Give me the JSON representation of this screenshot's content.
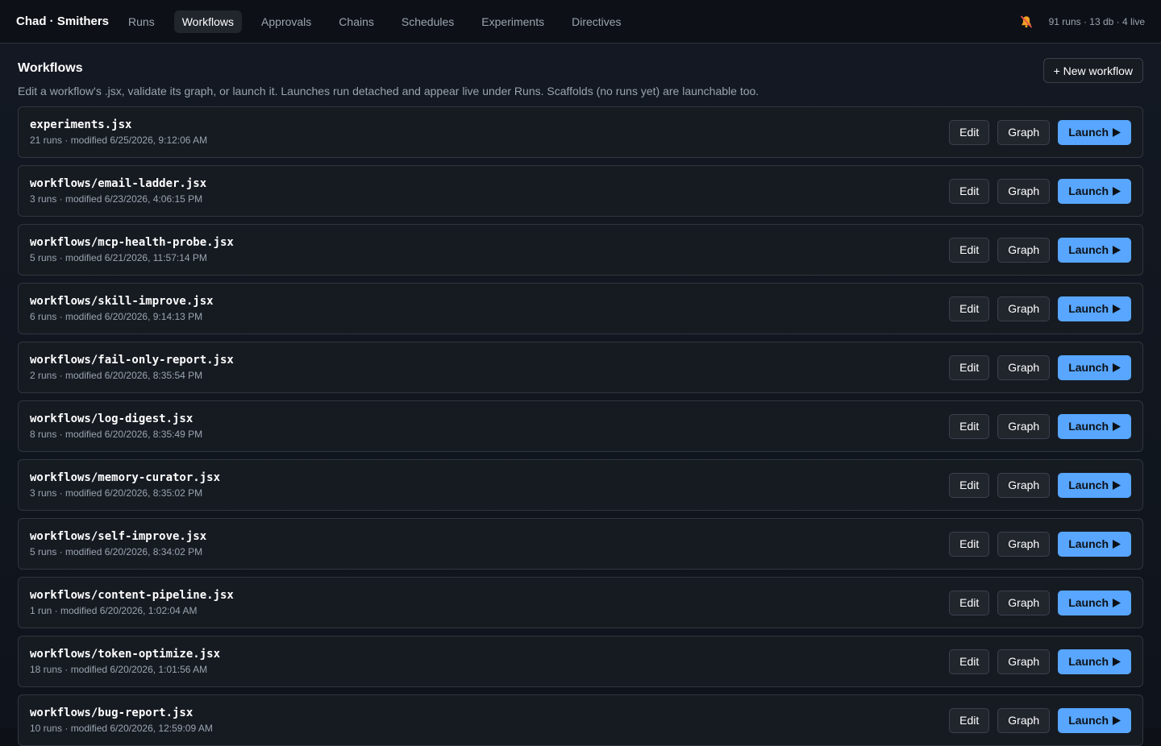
{
  "brand": "Chad · Smithers",
  "nav": [
    {
      "label": "Runs",
      "active": false
    },
    {
      "label": "Workflows",
      "active": true
    },
    {
      "label": "Approvals",
      "active": false
    },
    {
      "label": "Chains",
      "active": false
    },
    {
      "label": "Schedules",
      "active": false
    },
    {
      "label": "Experiments",
      "active": false
    },
    {
      "label": "Directives",
      "active": false
    }
  ],
  "status": {
    "text": "91 runs · 13 db · 4 live",
    "bell_icon": "bell-muted-icon"
  },
  "page": {
    "title": "Workflows",
    "description": "Edit a workflow's .jsx, validate its graph, or launch it. Launches run detached and appear live under Runs. Scaffolds (no runs yet) are launchable too.",
    "new_button": "+ New workflow"
  },
  "actions": {
    "edit": "Edit",
    "graph": "Graph",
    "launch": "Launch"
  },
  "colors": {
    "accent": "#58a6ff",
    "background": "#0d1117",
    "bell": "#f0a020"
  },
  "workflows": [
    {
      "name": "experiments.jsx",
      "meta": "21 runs · modified 6/25/2026, 9:12:06 AM"
    },
    {
      "name": "workflows/email-ladder.jsx",
      "meta": "3 runs · modified 6/23/2026, 4:06:15 PM"
    },
    {
      "name": "workflows/mcp-health-probe.jsx",
      "meta": "5 runs · modified 6/21/2026, 11:57:14 PM"
    },
    {
      "name": "workflows/skill-improve.jsx",
      "meta": "6 runs · modified 6/20/2026, 9:14:13 PM"
    },
    {
      "name": "workflows/fail-only-report.jsx",
      "meta": "2 runs · modified 6/20/2026, 8:35:54 PM"
    },
    {
      "name": "workflows/log-digest.jsx",
      "meta": "8 runs · modified 6/20/2026, 8:35:49 PM"
    },
    {
      "name": "workflows/memory-curator.jsx",
      "meta": "3 runs · modified 6/20/2026, 8:35:02 PM"
    },
    {
      "name": "workflows/self-improve.jsx",
      "meta": "5 runs · modified 6/20/2026, 8:34:02 PM"
    },
    {
      "name": "workflows/content-pipeline.jsx",
      "meta": "1 run · modified 6/20/2026, 1:02:04 AM"
    },
    {
      "name": "workflows/token-optimize.jsx",
      "meta": "18 runs · modified 6/20/2026, 1:01:56 AM"
    },
    {
      "name": "workflows/bug-report.jsx",
      "meta": "10 runs · modified 6/20/2026, 12:59:09 AM"
    }
  ]
}
